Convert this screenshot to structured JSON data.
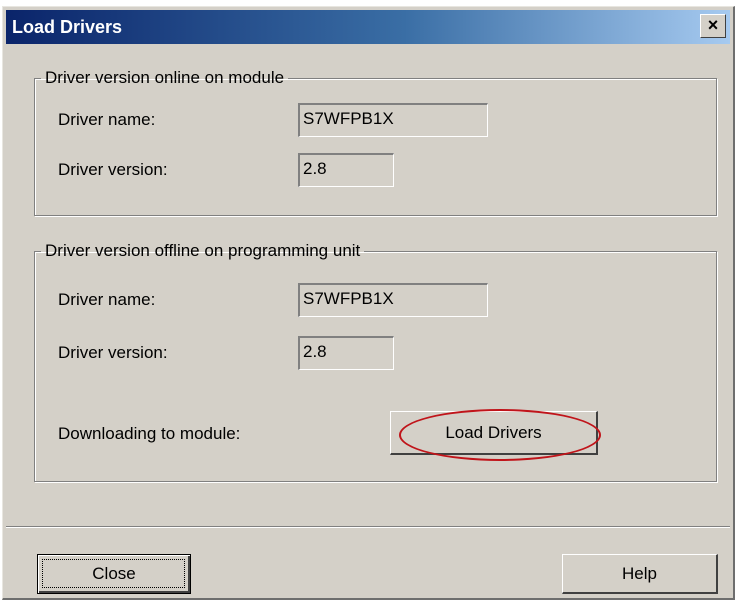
{
  "window": {
    "title": "Load Drivers",
    "close_glyph": "×"
  },
  "online_group": {
    "title": "Driver version online on module",
    "name_label": "Driver name:",
    "name_value": "S7WFPB1X",
    "version_label": "Driver version:",
    "version_value": "2.8"
  },
  "offline_group": {
    "title": "Driver version offline on programming unit",
    "name_label": "Driver name:",
    "name_value": "S7WFPB1X",
    "version_label": "Driver version:",
    "version_value": "2.8",
    "download_label": "Downloading to module:",
    "load_button_label": "Load Drivers"
  },
  "footer": {
    "close_button_label": "Close",
    "help_button_label": "Help"
  },
  "colors": {
    "titlebar_start": "#0a246a",
    "titlebar_end": "#a6caf0",
    "dialog_face": "#d4d0c8",
    "highlight_oval": "#c0141a"
  },
  "icons": {
    "close": "close-icon"
  }
}
